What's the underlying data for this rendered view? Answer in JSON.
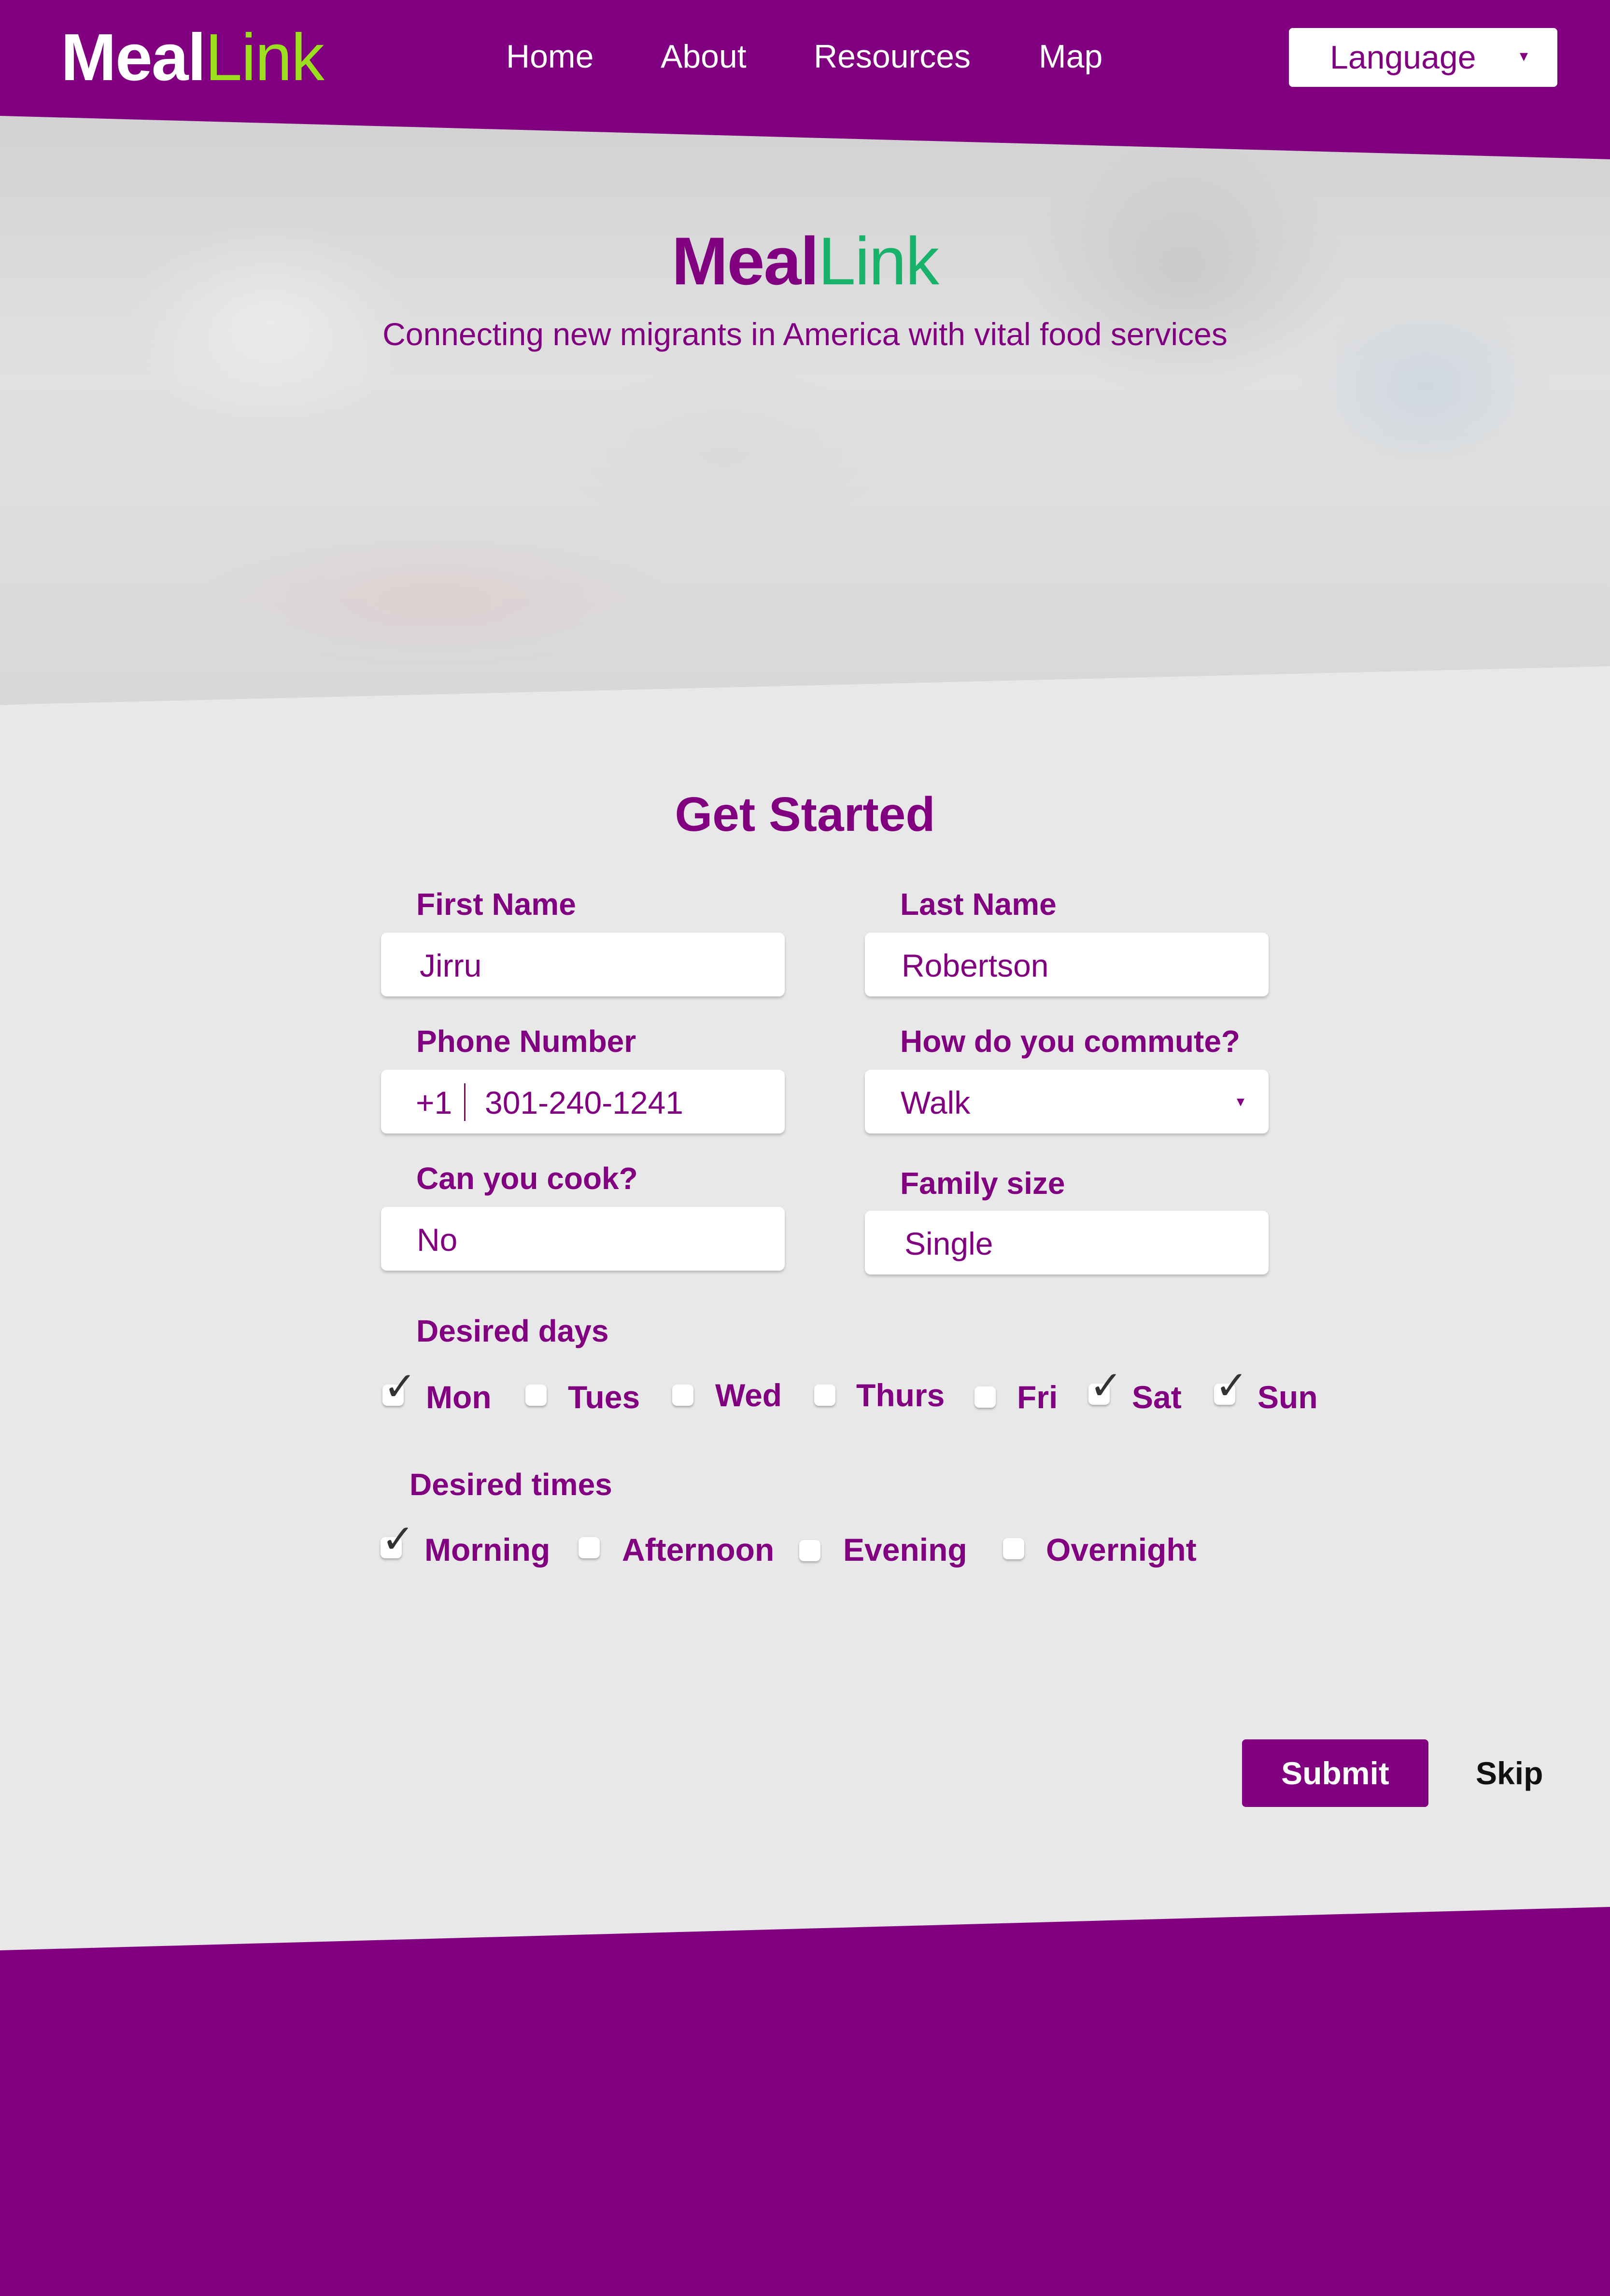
{
  "brand": {
    "part1": "Meal",
    "part2": "Link"
  },
  "nav": {
    "items": [
      {
        "label": "Home"
      },
      {
        "label": "About"
      },
      {
        "label": "Resources"
      },
      {
        "label": "Map"
      }
    ],
    "language": {
      "label": "Language",
      "caret": "▾"
    }
  },
  "hero": {
    "title_part1": "Meal",
    "title_part2": "Link",
    "subtitle": "Connecting new migrants in America with vital food services"
  },
  "form": {
    "title": "Get Started",
    "first_name": {
      "label": "First Name",
      "value": "Jirru"
    },
    "last_name": {
      "label": "Last Name",
      "value": "Robertson"
    },
    "phone": {
      "label": "Phone Number",
      "country_code": "+1",
      "value": "301-240-1241"
    },
    "commute": {
      "label": "How do you commute?",
      "value": "Walk",
      "caret": "▾"
    },
    "cook": {
      "label": "Can you cook?",
      "value": "No"
    },
    "family": {
      "label": "Family size",
      "value": "Single"
    },
    "days": {
      "label": "Desired days",
      "options": [
        {
          "label": "Mon",
          "checked": true
        },
        {
          "label": "Tues",
          "checked": false
        },
        {
          "label": "Wed",
          "checked": false
        },
        {
          "label": "Thurs",
          "checked": false
        },
        {
          "label": "Fri",
          "checked": false
        },
        {
          "label": "Sat",
          "checked": true
        },
        {
          "label": "Sun",
          "checked": true
        }
      ]
    },
    "times": {
      "label": "Desired times",
      "options": [
        {
          "label": "Morning",
          "checked": true
        },
        {
          "label": "Afternoon",
          "checked": false
        },
        {
          "label": "Evening",
          "checked": false
        },
        {
          "label": "Overnight",
          "checked": false
        }
      ]
    },
    "check_mark": "✓",
    "submit_label": "Submit",
    "skip_label": "Skip"
  },
  "colors": {
    "primary": "#800080",
    "logo_accent": "#9bdf1f",
    "hero_accent": "#18b26b",
    "form_bg": "#e8e8e8"
  }
}
